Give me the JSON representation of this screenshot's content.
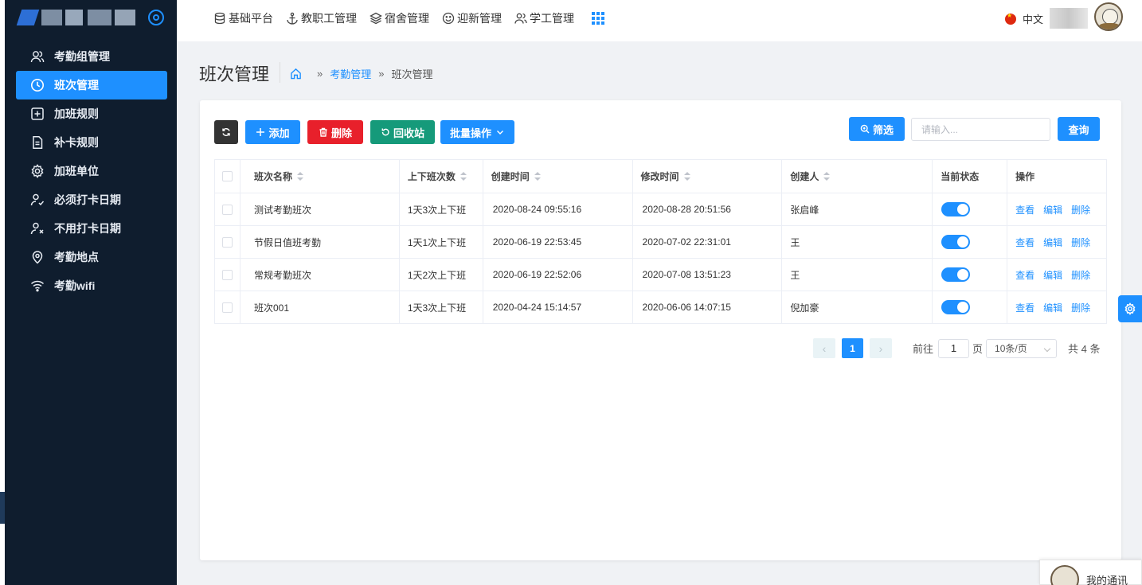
{
  "sidebar": {
    "items": [
      {
        "label": "考勤组管理",
        "icon": "users-icon"
      },
      {
        "label": "班次管理",
        "icon": "clock-icon",
        "active": true
      },
      {
        "label": "加班规则",
        "icon": "plus-square-icon"
      },
      {
        "label": "补卡规则",
        "icon": "document-icon"
      },
      {
        "label": "加班单位",
        "icon": "gear-icon"
      },
      {
        "label": "必须打卡日期",
        "icon": "user-check-icon"
      },
      {
        "label": "不用打卡日期",
        "icon": "user-x-icon"
      },
      {
        "label": "考勤地点",
        "icon": "location-icon"
      },
      {
        "label": "考勤wifi",
        "icon": "wifi-icon"
      }
    ]
  },
  "topnav": {
    "items": [
      {
        "label": "基础平台",
        "icon": "database-icon"
      },
      {
        "label": "教职工管理",
        "icon": "anchor-icon"
      },
      {
        "label": "宿舍管理",
        "icon": "layers-icon"
      },
      {
        "label": "迎新管理",
        "icon": "smile-icon"
      },
      {
        "label": "学工管理",
        "icon": "user-group-icon"
      }
    ],
    "language": "中文"
  },
  "page": {
    "title": "班次管理",
    "breadcrumb": {
      "section": "考勤管理",
      "current": "班次管理",
      "separator": "»"
    }
  },
  "toolbar": {
    "add": "添加",
    "delete": "删除",
    "recycle": "回收站",
    "batch": "批量操作",
    "filter": "筛选",
    "search_placeholder": "请输入...",
    "query": "查询"
  },
  "table": {
    "headers": {
      "name": "班次名称",
      "times": "上下班次数",
      "created": "创建时间",
      "modified": "修改时间",
      "creator": "创建人",
      "status": "当前状态",
      "actions": "操作"
    },
    "actions": {
      "view": "查看",
      "edit": "编辑",
      "delete": "删除"
    },
    "rows": [
      {
        "name": "测试考勤班次",
        "times": "1天3次上下班",
        "created": "2020-08-24 09:55:16",
        "modified": "2020-08-28 20:51:56",
        "creator": "张启峰",
        "enabled": true
      },
      {
        "name": "节假日值班考勤",
        "times": "1天1次上下班",
        "created": "2020-06-19 22:53:45",
        "modified": "2020-07-02 22:31:01",
        "creator": "王",
        "enabled": true
      },
      {
        "name": "常规考勤班次",
        "times": "1天2次上下班",
        "created": "2020-06-19 22:52:06",
        "modified": "2020-07-08 13:51:23",
        "creator": "王",
        "enabled": true
      },
      {
        "name": "班次001",
        "times": "1天3次上下班",
        "created": "2020-04-24 15:14:57",
        "modified": "2020-06-06 14:07:15",
        "creator": "倪加豪",
        "enabled": true
      }
    ]
  },
  "pagination": {
    "prev": "‹",
    "current_page": "1",
    "next": "›",
    "goto_label": "前往",
    "goto_value": "1",
    "page_unit": "页",
    "page_size": "10条/页",
    "total": "共 4 条"
  },
  "contact": {
    "label": "我的通讯"
  },
  "colors": {
    "primary": "#1e90ff",
    "danger": "#e8202b",
    "success": "#159a7a",
    "sidebar_bg": "#0f1d2e"
  }
}
